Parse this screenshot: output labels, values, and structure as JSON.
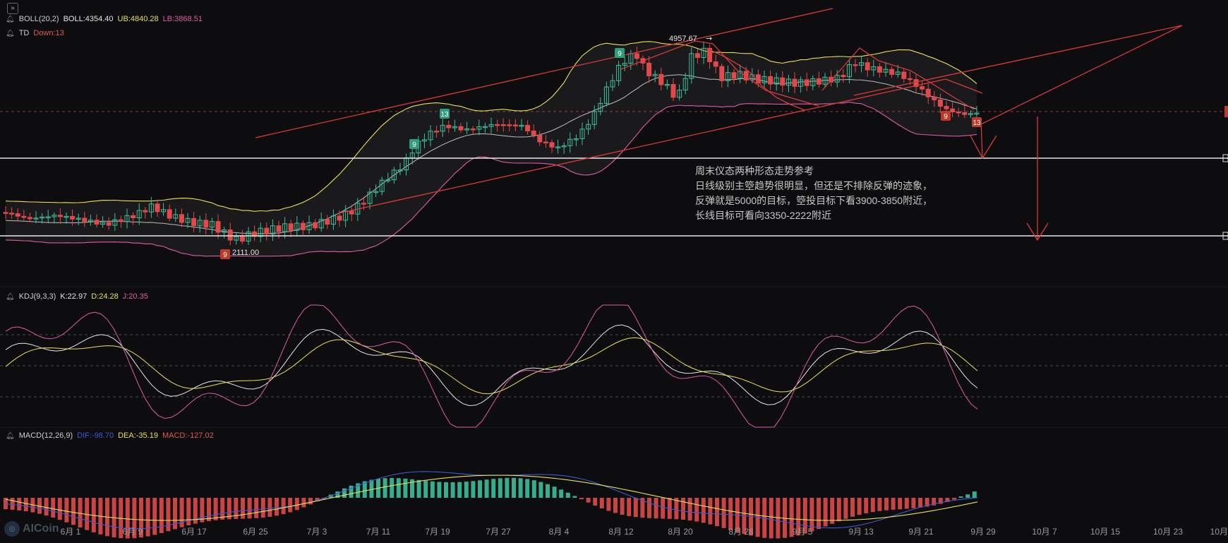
{
  "toggle_icon": "double-chevron-right-icon",
  "boll": {
    "label": "BOLL(20,2)",
    "boll": "BOLL:4354.40",
    "ub": "UB:4840.28",
    "lb": "LB:3868.51",
    "colors": {
      "label": "#cfcfcf",
      "boll": "#e6e6e6",
      "ub": "#e8e05a",
      "lb": "#e05aa8"
    }
  },
  "td": {
    "label": "TD",
    "value": "Down:13",
    "color": "#e05a5a"
  },
  "kdj": {
    "label": "KDJ(9,3,3)",
    "k": "K:22.97",
    "d": "D:24.28",
    "j": "J:20.35",
    "colors": {
      "k": "#e6e6e6",
      "d": "#e8e05a",
      "j": "#e05aa8"
    }
  },
  "macd": {
    "label": "MACD(12,26,9)",
    "dif": "DIF:-98.70",
    "dea": "DEA:-35.19",
    "macd": "MACD:-127.02",
    "colors": {
      "dif": "#3b5bd6",
      "dea": "#e8e05a",
      "macd": "#e05a5a"
    }
  },
  "annotations": {
    "high": "4957.67",
    "low": "2111.00",
    "td_markers": [
      "9",
      "13",
      "9",
      "9",
      "9",
      "13"
    ]
  },
  "note": "周末仪态两种形态走势参考\n日线级别主箜趋势很明显，但还是不排除反弹的迹象，反弹就是5000的目标，箜投目标下看3900-3850附近，长线目标可看向3350-2222附近",
  "x_axis": [
    "6月 1",
    "6月 9",
    "6月 17",
    "6月 25",
    "7月 3",
    "7月 11",
    "7月 19",
    "7月 27",
    "8月 4",
    "8月 12",
    "8月 20",
    "8月 28",
    "9月 5",
    "9月 13",
    "9月 21",
    "9月 29",
    "10月 7",
    "10月 15",
    "10月 23",
    "10月"
  ],
  "logo": "AICoin",
  "colors": {
    "up": "#3bbf9a",
    "down": "#e04a4a",
    "trend": "#d93a3a",
    "hline": "#e8e8e8"
  }
}
